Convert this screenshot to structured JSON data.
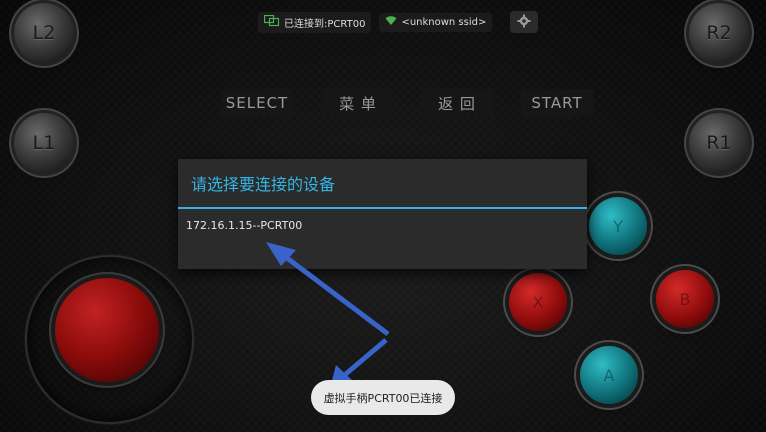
{
  "status_bar": {
    "connection_text": "已连接到:PCRT00",
    "ssid_text": "<unknown ssid>",
    "colors": {
      "connected_icon": "#4caf50",
      "wifi_icon": "#4caf50"
    }
  },
  "shoulders": {
    "l2": "L2",
    "l1": "L1",
    "r2": "R2",
    "r1": "R1"
  },
  "menu": {
    "select": "SELECT",
    "menu": "菜 单",
    "back": "返 回",
    "start": "START"
  },
  "dialog": {
    "title": "请选择要连接的设备",
    "items": [
      "172.16.1.15--PCRT00"
    ],
    "accent_color": "#33b5e5"
  },
  "action_buttons": {
    "top_letter": "Y",
    "left_letter": "X",
    "right_letter": "B",
    "bottom_letter": "A"
  },
  "toast": {
    "text": "虚拟手柄PCRT00已连接"
  },
  "colors": {
    "arrow": "#3a63c9"
  }
}
